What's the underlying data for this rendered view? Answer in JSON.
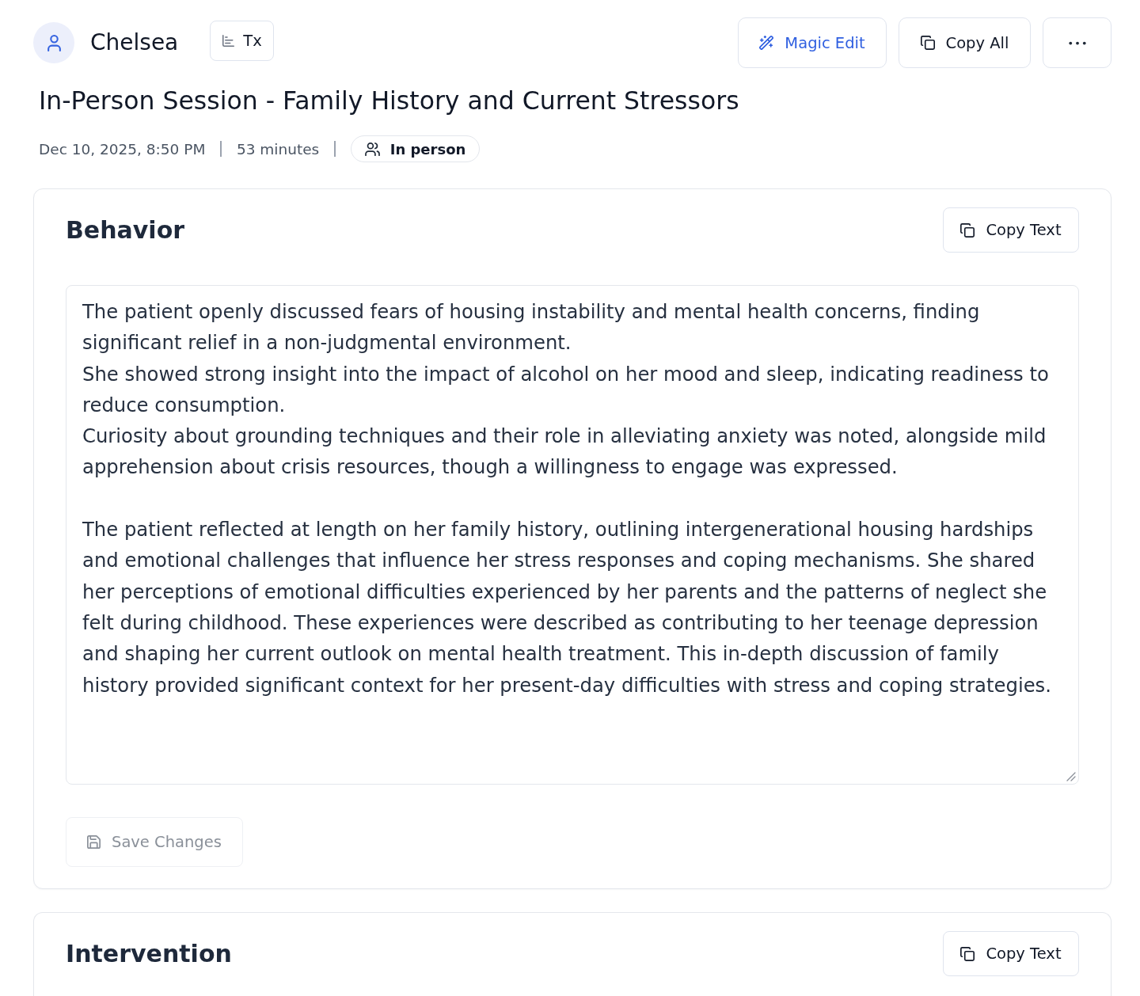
{
  "header": {
    "client_name": "Chelsea",
    "transcript_button": {
      "label": "Tx"
    },
    "actions": [
      {
        "kind": "magic",
        "label": "Magic Edit"
      },
      {
        "kind": "copy",
        "label": "Copy All"
      },
      {
        "kind": "more"
      }
    ]
  },
  "session": {
    "title": "In-Person Session - Family History and Current Stressors",
    "date": "Dec 10, 2025, 8:50 PM",
    "duration": "53 minutes",
    "mode": "In person"
  },
  "sections": [
    {
      "title": "Behavior",
      "copy_button": "Copy Text",
      "text": "The patient openly discussed fears of housing instability and mental health concerns, finding significant relief in a non-judgmental environment.\nShe showed strong insight into the impact of alcohol on her mood and sleep, indicating readiness to reduce consumption.\nCuriosity about grounding techniques and their role in alleviating anxiety was noted, alongside mild apprehension about crisis resources, though a willingness to engage was expressed.\n\nThe patient reflected at length on her family history, outlining intergenerational housing hardships and emotional challenges that influence her stress responses and coping mechanisms. She shared her perceptions of emotional difficulties experienced by her parents and the patterns of neglect she felt during childhood. These experiences were described as contributing to her teenage depression and shaping her current outlook on mental health treatment. This in-depth discussion of family history provided significant context for her present-day difficulties with stress and coping strategies.",
      "save_button": {
        "label": "Save Changes",
        "disabled": true
      }
    },
    {
      "title": "Intervention",
      "copy_button": "Copy Text"
    }
  ]
}
